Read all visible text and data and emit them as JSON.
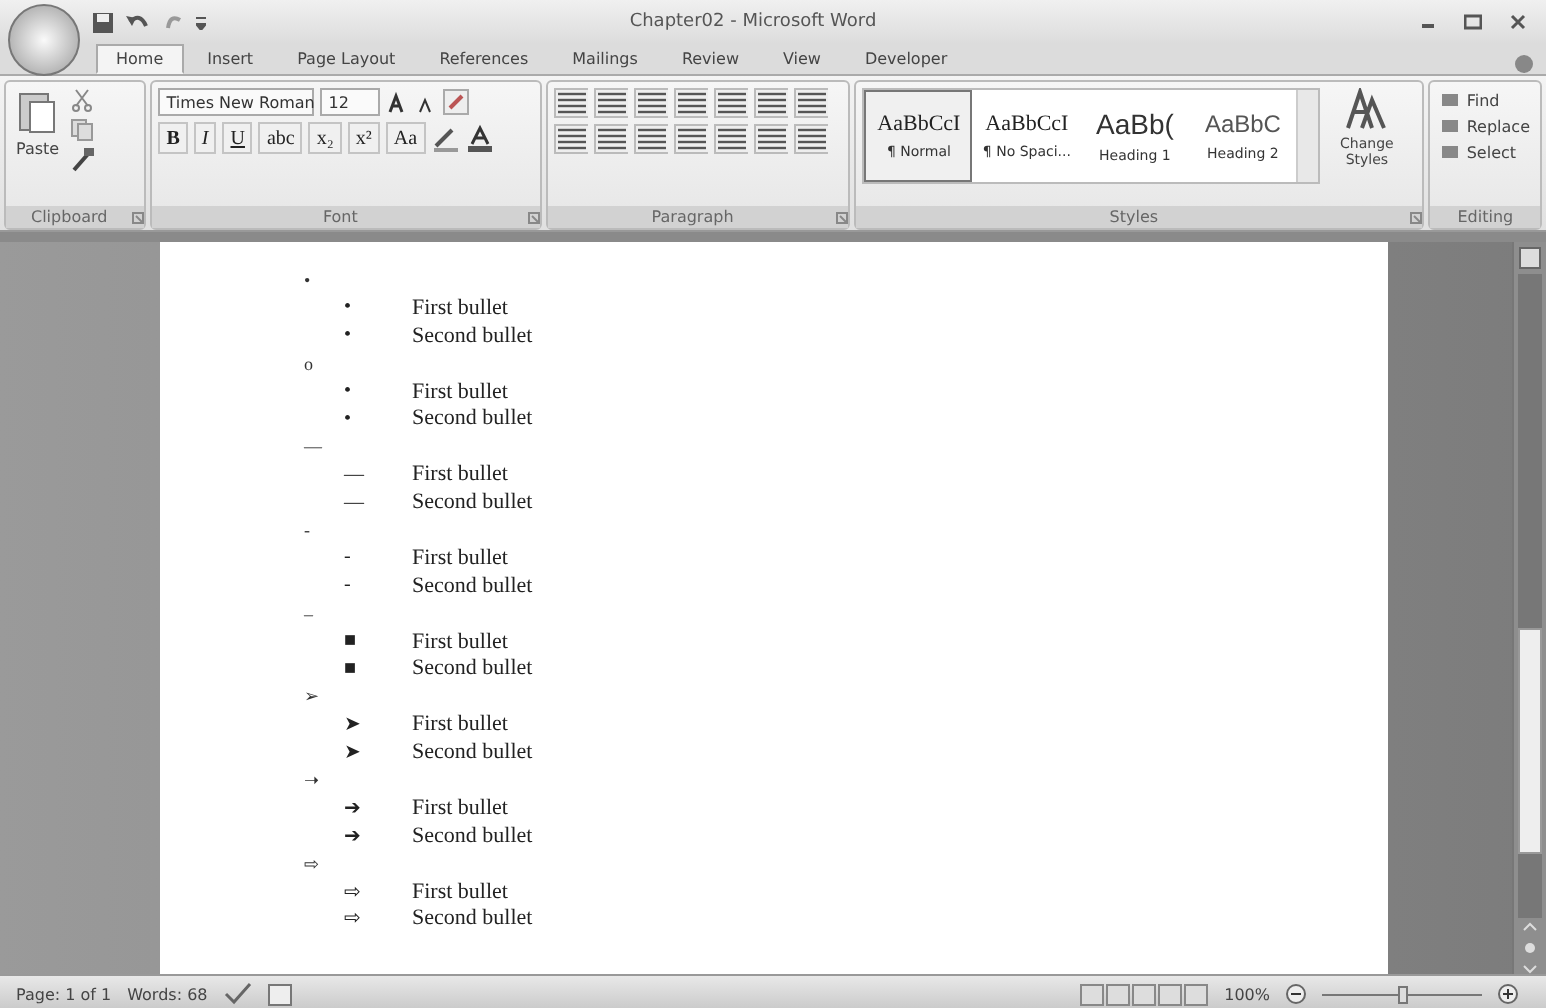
{
  "window": {
    "title": "Chapter02 - Microsoft Word"
  },
  "tabs": [
    {
      "label": "Home",
      "selected": true
    },
    {
      "label": "Insert",
      "selected": false
    },
    {
      "label": "Page Layout",
      "selected": false
    },
    {
      "label": "References",
      "selected": false
    },
    {
      "label": "Mailings",
      "selected": false
    },
    {
      "label": "Review",
      "selected": false
    },
    {
      "label": "View",
      "selected": false
    },
    {
      "label": "Developer",
      "selected": false
    }
  ],
  "ribbon": {
    "clipboard": {
      "label": "Clipboard",
      "paste": "Paste"
    },
    "font": {
      "label": "Font",
      "family": "Times New Roman",
      "size": "12",
      "format_buttons": [
        "B",
        "I",
        "U",
        "abc",
        "x₂",
        "x²",
        "Aa"
      ]
    },
    "paragraph": {
      "label": "Paragraph"
    },
    "styles": {
      "label": "Styles",
      "change_styles": "Change Styles",
      "gallery": [
        {
          "preview": "AaBbCcI",
          "name": "¶ Normal",
          "selected": true
        },
        {
          "preview": "AaBbCcI",
          "name": "¶ No Spaci...",
          "selected": false
        },
        {
          "preview": "AaBb(",
          "name": "Heading 1",
          "selected": false
        },
        {
          "preview": "AaBbC",
          "name": "Heading 2",
          "selected": false
        }
      ]
    },
    "editing": {
      "label": "Editing",
      "buttons": [
        "Find",
        "Replace",
        "Select"
      ]
    }
  },
  "document": {
    "items": [
      {
        "marker": "•",
        "children": [
          {
            "marker": "•",
            "text": "First bullet"
          },
          {
            "marker": "•",
            "text": "Second bullet"
          }
        ]
      },
      {
        "marker": "o",
        "children": [
          {
            "marker": "•",
            "text": "First bullet"
          },
          {
            "marker": "•",
            "text": "Second bullet"
          }
        ]
      },
      {
        "marker": "—",
        "children": [
          {
            "marker": "—",
            "text": "First bullet"
          },
          {
            "marker": "—",
            "text": "Second bullet"
          }
        ]
      },
      {
        "marker": "-",
        "children": [
          {
            "marker": "-",
            "text": "First bullet"
          },
          {
            "marker": "-",
            "text": "Second bullet"
          }
        ]
      },
      {
        "marker": "–",
        "children": [
          {
            "marker": "■",
            "text": "First bullet"
          },
          {
            "marker": "■",
            "text": "Second bullet"
          }
        ]
      },
      {
        "marker": "➢",
        "children": [
          {
            "marker": "➤",
            "text": "First bullet"
          },
          {
            "marker": "➤",
            "text": "Second bullet"
          }
        ]
      },
      {
        "marker": "➝",
        "children": [
          {
            "marker": "➔",
            "text": "First bullet"
          },
          {
            "marker": "➔",
            "text": "Second bullet"
          }
        ]
      },
      {
        "marker": "⇨",
        "children": [
          {
            "marker": "⇨",
            "text": "First bullet"
          },
          {
            "marker": "⇨",
            "text": "Second bullet"
          }
        ]
      }
    ]
  },
  "status_bar": {
    "page": "Page: 1 of 1",
    "words": "Words: 68",
    "zoom": "100%",
    "zoom_slider": {
      "level": 0.5
    }
  }
}
